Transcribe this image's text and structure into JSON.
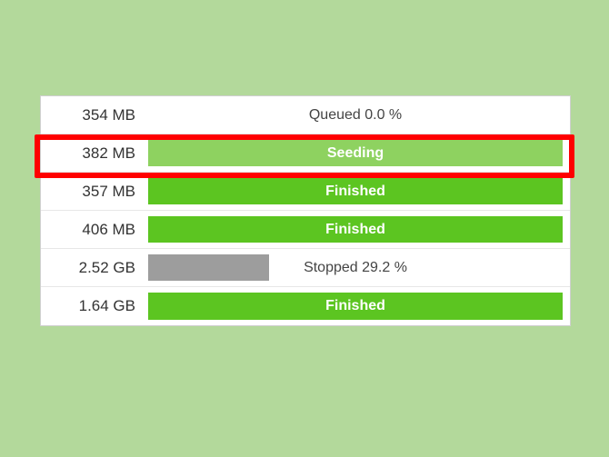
{
  "colors": {
    "green": "#5cc521",
    "lime": "#8ed260",
    "gray": "#9d9d9d",
    "highlight": "#ff0000"
  },
  "rows": [
    {
      "size": "354 MB",
      "status": "Queued 0.0 %",
      "fill_pct": 0,
      "fill_color": "none",
      "label_style": "dark"
    },
    {
      "size": "382 MB",
      "status": "Seeding",
      "fill_pct": 100,
      "fill_color": "lime",
      "label_style": "white",
      "highlighted": true
    },
    {
      "size": "357 MB",
      "status": "Finished",
      "fill_pct": 100,
      "fill_color": "green",
      "label_style": "white"
    },
    {
      "size": "406 MB",
      "status": "Finished",
      "fill_pct": 100,
      "fill_color": "green",
      "label_style": "white"
    },
    {
      "size": "2.52 GB",
      "status": "Stopped 29.2 %",
      "fill_pct": 29.2,
      "fill_color": "gray",
      "label_style": "dark"
    },
    {
      "size": "1.64 GB",
      "status": "Finished",
      "fill_pct": 100,
      "fill_color": "green",
      "label_style": "white"
    }
  ]
}
